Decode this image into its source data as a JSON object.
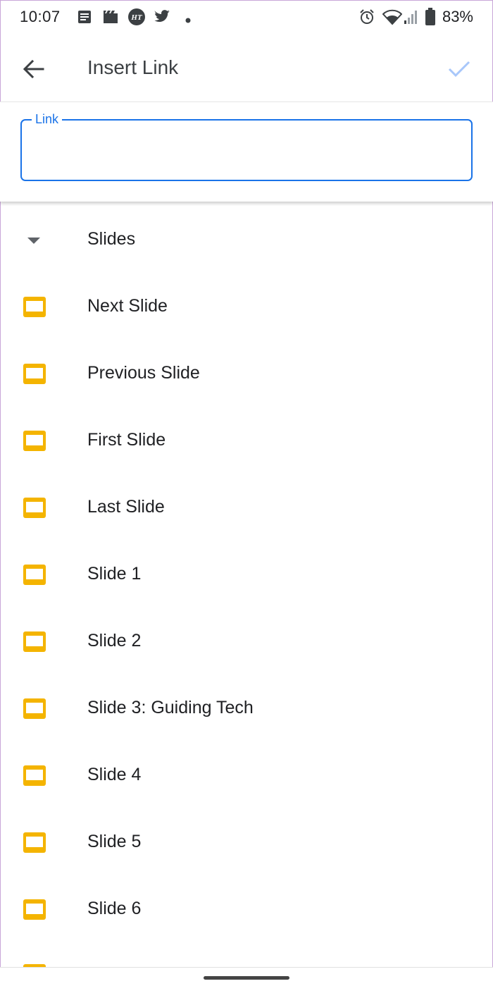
{
  "status_bar": {
    "time": "10:07",
    "battery": "83%",
    "icons": [
      "news-icon",
      "clapper-icon",
      "ht-icon",
      "twitter-icon",
      "dot-icon",
      "alarm-icon",
      "wifi-icon",
      "signal-icon",
      "battery-icon"
    ]
  },
  "toolbar": {
    "title": "Insert Link",
    "back_icon": "arrow-back-icon",
    "confirm_icon": "check-icon"
  },
  "link_field": {
    "label": "Link",
    "value": ""
  },
  "list": {
    "section_label": "Slides",
    "items": [
      {
        "label": "Next Slide"
      },
      {
        "label": "Previous Slide"
      },
      {
        "label": "First Slide"
      },
      {
        "label": "Last Slide"
      },
      {
        "label": "Slide 1"
      },
      {
        "label": "Slide 2"
      },
      {
        "label": "Slide 3: Guiding Tech"
      },
      {
        "label": "Slide 4"
      },
      {
        "label": "Slide 5"
      },
      {
        "label": "Slide 6"
      }
    ]
  },
  "colors": {
    "accent": "#1a73e8",
    "slide_icon": "#f4b400",
    "confirm_disabled": "#a8c7fa"
  }
}
